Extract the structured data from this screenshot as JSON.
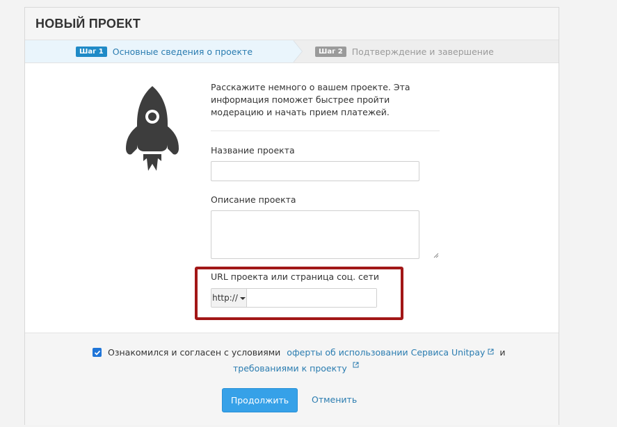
{
  "header": {
    "title": "НОВЫЙ ПРОЕКТ"
  },
  "steps": [
    {
      "badge": "Шаг 1",
      "label": "Основные сведения о проекте",
      "active": true
    },
    {
      "badge": "Шаг 2",
      "label": "Подтверждение и завершение",
      "active": false
    }
  ],
  "intro_text": "Расскажите немного о вашем проекте. Эта информация поможет быстрее пройти модерацию и начать прием платежей.",
  "form": {
    "name_label": "Название проекта",
    "name_value": "",
    "description_label": "Описание проекта",
    "description_value": "",
    "url_label": "URL проекта или страница соц. сети",
    "url_prefix": "http://",
    "url_value": ""
  },
  "agreement": {
    "checked": true,
    "text": "Ознакомился и согласен с условиями",
    "offer_link": "оферты об использовании Сервиса Unitpay",
    "and_word": "и",
    "requirements_link": "требованиями к проекту"
  },
  "actions": {
    "continue_label": "Продолжить",
    "cancel_label": "Отменить"
  },
  "colors": {
    "accent": "#36a1e8",
    "link": "#2a7cb0",
    "highlight": "#a21717",
    "step_active_bg": "#eaf5fc"
  },
  "icons": {
    "hero": "rocket-icon",
    "external": "external-link-icon",
    "dropdown": "caret-down-icon"
  }
}
